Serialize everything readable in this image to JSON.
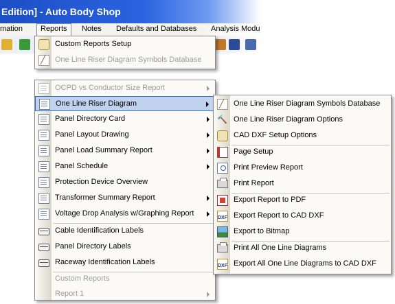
{
  "window": {
    "title": "Edition] - Auto Body Shop"
  },
  "menubar": {
    "items": [
      {
        "label": "mation"
      },
      {
        "label": "Reports"
      },
      {
        "label": "Notes"
      },
      {
        "label": "Defaults and Databases"
      },
      {
        "label": "Analysis Modu"
      }
    ]
  },
  "reports_menu": {
    "items": [
      {
        "label": "Custom Reports Setup",
        "icon": "setup-icon"
      },
      {
        "label": "One Line Riser Diagram Symbols Database",
        "icon": "stencil-icon"
      },
      {
        "label": "OCPD vs Conductor Size Report",
        "icon": "report-icon"
      },
      {
        "label": "One Line Riser Diagram",
        "icon": "report-icon"
      },
      {
        "label": "Panel Directory Card",
        "icon": "report-icon"
      },
      {
        "label": "Panel Layout Drawing",
        "icon": "report-icon"
      },
      {
        "label": "Panel Load Summary Report",
        "icon": "report-icon"
      },
      {
        "label": "Panel Schedule",
        "icon": "report-icon"
      },
      {
        "label": "Protection Device Overview",
        "icon": "report-icon"
      },
      {
        "label": "Transformer Summary Report",
        "icon": "report-icon"
      },
      {
        "label": "Voltage Drop Analysis w/Graphing Report",
        "icon": "report-icon"
      },
      {
        "label": "Cable Identification Labels",
        "icon": "label-icon"
      },
      {
        "label": "Panel Directory Labels",
        "icon": "label-icon"
      },
      {
        "label": "Raceway Identification Labels",
        "icon": "label-icon"
      },
      {
        "label": "Custom Reports"
      },
      {
        "label": "Report 1"
      }
    ]
  },
  "submenu": {
    "items": [
      {
        "label": "One Line Riser Diagram Symbols Database",
        "icon": "stencil-icon"
      },
      {
        "label": "One Line Riser Diagram Options",
        "icon": "hammer-icon"
      },
      {
        "label": "CAD DXF Setup Options",
        "icon": "setup-icon"
      },
      {
        "label": "Page Setup",
        "icon": "page-setup-icon"
      },
      {
        "label": "Print Preview Report",
        "icon": "print-preview-icon"
      },
      {
        "label": "Print Report",
        "icon": "printer-icon"
      },
      {
        "label": "Export Report to PDF",
        "icon": "pdf-icon"
      },
      {
        "label": "Export Report to CAD DXF",
        "icon": "dxf-icon"
      },
      {
        "label": "Export to Bitmap",
        "icon": "bitmap-icon"
      },
      {
        "label": "Print All One Line Diagrams",
        "icon": "printer-icon"
      },
      {
        "label": "Export All One Line Diagrams to CAD DXF",
        "icon": "dxf-icon"
      }
    ]
  },
  "colors": {
    "title_bar": "#2a63e0",
    "highlight": "#c1d2ee",
    "highlight_border": "#316ac5",
    "disabled_text": "#9a9a9a"
  }
}
